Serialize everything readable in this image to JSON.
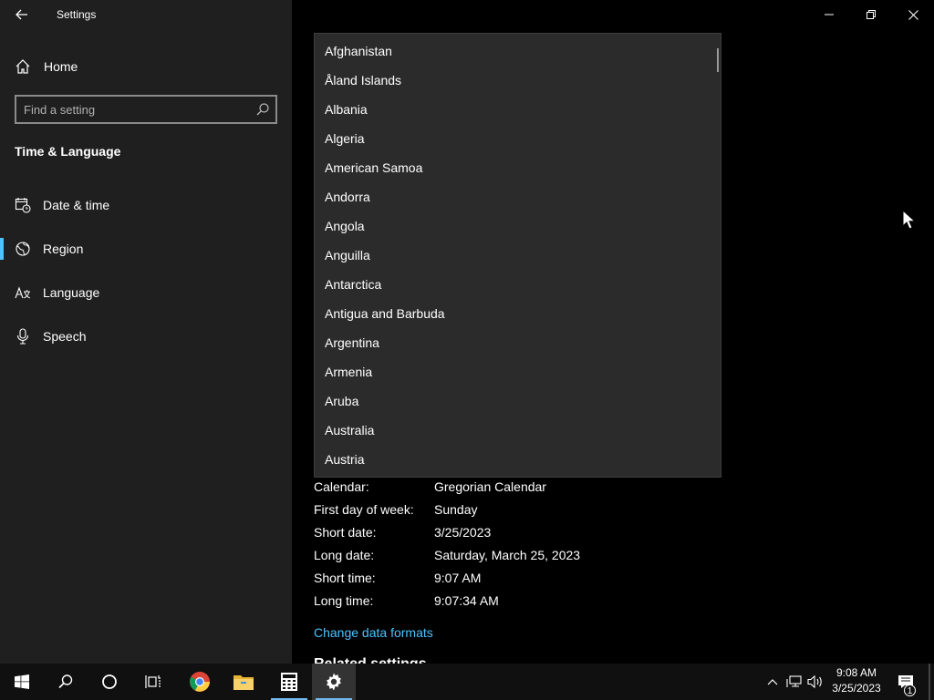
{
  "window": {
    "title": "Settings"
  },
  "sidebar": {
    "home_label": "Home",
    "search_placeholder": "Find a setting",
    "section_title": "Time & Language",
    "items": [
      {
        "label": "Date & time",
        "icon": "calendar-clock-icon",
        "selected": false
      },
      {
        "label": "Region",
        "icon": "globe-icon",
        "selected": true
      },
      {
        "label": "Language",
        "icon": "language-icon",
        "selected": false
      },
      {
        "label": "Speech",
        "icon": "microphone-icon",
        "selected": false
      }
    ]
  },
  "dropdown": {
    "options": [
      "Afghanistan",
      "Åland Islands",
      "Albania",
      "Algeria",
      "American Samoa",
      "Andorra",
      "Angola",
      "Anguilla",
      "Antarctica",
      "Antigua and Barbuda",
      "Argentina",
      "Armenia",
      "Aruba",
      "Australia",
      "Austria"
    ]
  },
  "formats": [
    {
      "label": "Calendar:",
      "value": "Gregorian Calendar"
    },
    {
      "label": "First day of week:",
      "value": "Sunday"
    },
    {
      "label": "Short date:",
      "value": "3/25/2023"
    },
    {
      "label": "Long date:",
      "value": "Saturday, March 25, 2023"
    },
    {
      "label": "Short time:",
      "value": "9:07 AM"
    },
    {
      "label": "Long time:",
      "value": "9:07:34 AM"
    }
  ],
  "change_formats_link": "Change data formats",
  "related_settings_title": "Related settings",
  "taskbar": {
    "clock_time": "9:08 AM",
    "clock_date": "3/25/2023",
    "notification_count": "1"
  },
  "colors": {
    "accent": "#4cc2ff",
    "sidebar_bg": "#1f1f1f",
    "dropdown_bg": "#2b2b2b"
  }
}
